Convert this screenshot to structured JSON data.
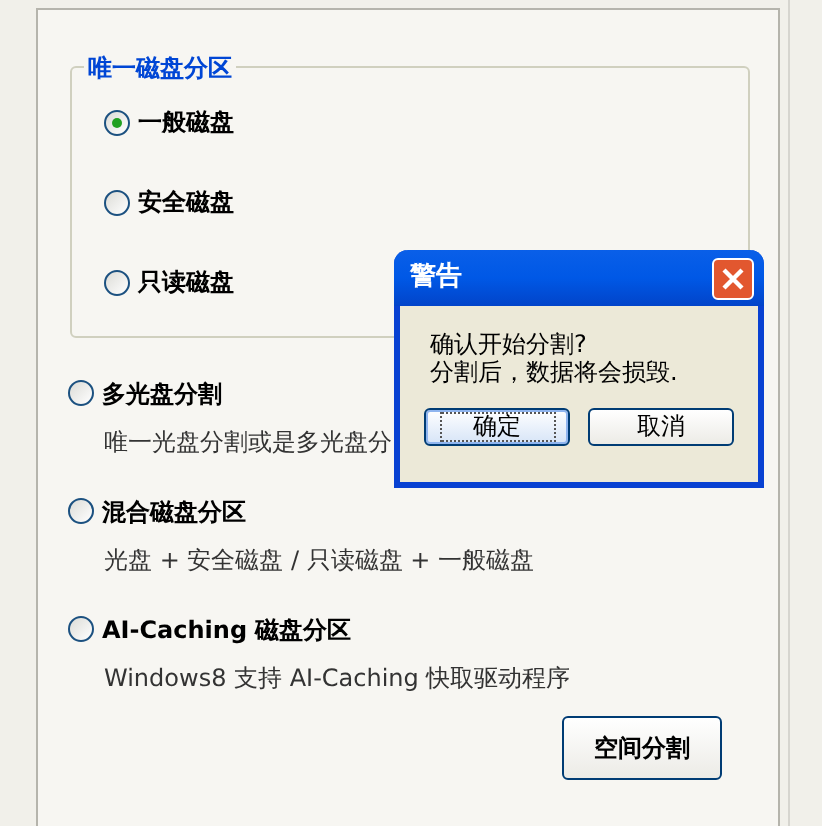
{
  "group": {
    "title": "唯一磁盘分区",
    "options": [
      {
        "label": "一般磁盘",
        "selected": true
      },
      {
        "label": "安全磁盘",
        "selected": false
      },
      {
        "label": "只读磁盘",
        "selected": false
      }
    ]
  },
  "modes": [
    {
      "label": "多光盘分割",
      "description": "唯一光盘分割或是多光盘分",
      "selected": false
    },
    {
      "label": "混合磁盘分区",
      "description": "光盘 + 安全磁盘 / 只读磁盘 + 一般磁盘",
      "selected": false
    },
    {
      "label": "AI-Caching 磁盘分区",
      "description": "Windows8 支持 AI-Caching 快取驱动程序",
      "selected": false
    }
  ],
  "button": "空间分割",
  "dialog": {
    "title": "警告",
    "lines": [
      "确认开始分割?",
      "分割后，数据将会损毁."
    ],
    "buttons": [
      {
        "label": "确定",
        "focused": true
      },
      {
        "label": "取消",
        "focused": false
      }
    ]
  }
}
